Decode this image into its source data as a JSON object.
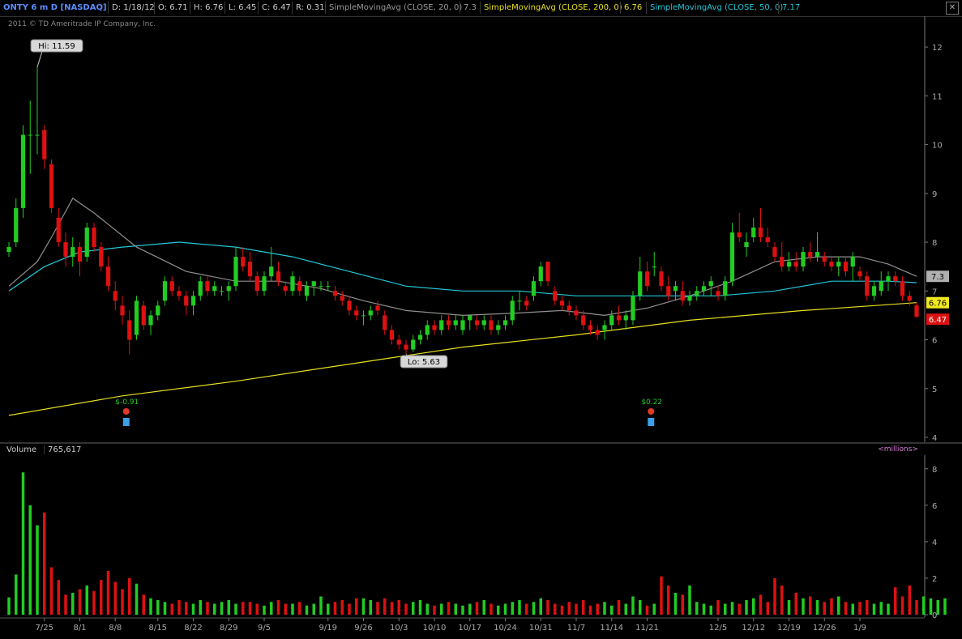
{
  "header": {
    "symbol": "ONTY 6 m D [NASDAQ]",
    "date": "D: 1/18/12",
    "open": "O: 6.71",
    "high": "H: 6.76",
    "low": "L: 6.45",
    "close": "C: 6.47",
    "range": "R: 0.31",
    "sma20_label": "SimpleMovingAvg (CLOSE, 20, 0)",
    "sma20_value": "7.3",
    "sma200_label": "SimpleMovingAvg (CLOSE, 200, 0)",
    "sma200_value": "6.76",
    "sma50_label": "SimpleMovingAvg (CLOSE, 50, 0)",
    "sma50_value": "7.17"
  },
  "copyright": "2011 © TD Ameritrade IP Company, Inc.",
  "volume_panel": {
    "label": "Volume",
    "value": "765,617",
    "unit": "<millions>"
  },
  "colors": {
    "up": "#22cc22",
    "down": "#dd1111",
    "sma20": "#909090",
    "sma50": "#22c8d8",
    "sma200": "#e8e020",
    "axis": "#777777"
  },
  "chart_data": {
    "type": "candlestick",
    "price_ylim": [
      4,
      12.3
    ],
    "price_ticks": [
      "4",
      "5",
      "6",
      "7",
      "8",
      "9",
      "10",
      "11",
      "12"
    ],
    "volume_ylim": [
      0,
      8.3
    ],
    "volume_ticks": [
      "0",
      "2",
      "4",
      "6",
      "8"
    ],
    "x_tick_labels": [
      "7/25",
      "8/1",
      "8/8",
      "8/15",
      "8/22",
      "8/29",
      "9/5",
      "9/19",
      "9/26",
      "10/3",
      "10/10",
      "10/17",
      "10/24",
      "10/31",
      "11/7",
      "11/14",
      "11/21",
      "12/5",
      "12/12",
      "12/19",
      "12/26",
      "1/9"
    ],
    "annotations": {
      "high": "Hi: 11.59",
      "low": "Lo: 5.63",
      "earnings": [
        "$-0.91",
        "$0.22"
      ]
    },
    "badges": {
      "sma20": "7.3",
      "sma200": "6.76",
      "last": "6.47"
    },
    "candles": [
      [
        7.8,
        8.0,
        7.7,
        7.9
      ],
      [
        8.0,
        8.9,
        7.9,
        8.7
      ],
      [
        8.7,
        10.4,
        8.5,
        10.2
      ],
      [
        10.2,
        10.9,
        9.4,
        10.2
      ],
      [
        10.2,
        11.59,
        9.8,
        10.2
      ],
      [
        10.3,
        10.4,
        9.5,
        9.7
      ],
      [
        9.6,
        9.7,
        8.6,
        8.7
      ],
      [
        8.5,
        8.7,
        7.9,
        8.0
      ],
      [
        8.0,
        8.2,
        7.5,
        7.7
      ],
      [
        7.7,
        8.1,
        7.5,
        7.9
      ],
      [
        7.9,
        8.0,
        7.3,
        7.6
      ],
      [
        7.7,
        8.4,
        7.6,
        8.3
      ],
      [
        8.3,
        8.4,
        7.8,
        7.9
      ],
      [
        7.9,
        8.0,
        7.4,
        7.5
      ],
      [
        7.5,
        7.7,
        7.0,
        7.1
      ],
      [
        7.0,
        7.2,
        6.6,
        6.8
      ],
      [
        6.7,
        6.9,
        6.3,
        6.5
      ],
      [
        6.4,
        6.6,
        5.7,
        6.0
      ],
      [
        6.1,
        6.9,
        6.0,
        6.8
      ],
      [
        6.7,
        6.8,
        6.2,
        6.3
      ],
      [
        6.3,
        6.6,
        6.1,
        6.5
      ],
      [
        6.5,
        6.8,
        6.4,
        6.7
      ],
      [
        6.8,
        7.3,
        6.7,
        7.2
      ],
      [
        7.2,
        7.3,
        6.9,
        7.0
      ],
      [
        7.0,
        7.1,
        6.8,
        6.9
      ],
      [
        6.9,
        7.0,
        6.5,
        6.7
      ],
      [
        6.7,
        7.0,
        6.5,
        6.9
      ],
      [
        6.9,
        7.3,
        6.8,
        7.2
      ],
      [
        7.2,
        7.3,
        6.9,
        7.0
      ],
      [
        7.0,
        7.2,
        6.9,
        7.1
      ],
      [
        7.0,
        7.1,
        6.9,
        7.0
      ],
      [
        7.0,
        7.2,
        6.8,
        7.1
      ],
      [
        7.1,
        7.9,
        7.0,
        7.7
      ],
      [
        7.7,
        7.9,
        7.4,
        7.5
      ],
      [
        7.6,
        7.8,
        7.2,
        7.3
      ],
      [
        7.3,
        7.4,
        6.9,
        7.0
      ],
      [
        7.0,
        7.4,
        6.9,
        7.3
      ],
      [
        7.3,
        7.9,
        7.2,
        7.5
      ],
      [
        7.4,
        7.6,
        7.1,
        7.2
      ],
      [
        7.1,
        7.2,
        6.9,
        7.0
      ],
      [
        7.0,
        7.4,
        6.9,
        7.3
      ],
      [
        7.2,
        7.3,
        6.9,
        7.0
      ],
      [
        6.9,
        7.2,
        6.8,
        7.1
      ],
      [
        7.1,
        7.2,
        6.9,
        7.2
      ],
      [
        7.1,
        7.2,
        7.0,
        7.1
      ],
      [
        7.1,
        7.2,
        7.0,
        7.1
      ],
      [
        7.0,
        7.1,
        6.8,
        6.9
      ],
      [
        6.9,
        7.0,
        6.7,
        6.8
      ],
      [
        6.8,
        6.9,
        6.5,
        6.6
      ],
      [
        6.6,
        6.7,
        6.4,
        6.5
      ],
      [
        6.5,
        6.6,
        6.3,
        6.5
      ],
      [
        6.5,
        6.7,
        6.4,
        6.6
      ],
      [
        6.7,
        6.8,
        6.5,
        6.6
      ],
      [
        6.5,
        6.6,
        6.1,
        6.2
      ],
      [
        6.2,
        6.3,
        5.9,
        6.0
      ],
      [
        6.0,
        6.1,
        5.8,
        5.9
      ],
      [
        5.9,
        6.0,
        5.7,
        5.8
      ],
      [
        5.8,
        6.1,
        5.75,
        6.0
      ],
      [
        6.0,
        6.2,
        5.9,
        6.1
      ],
      [
        6.1,
        6.4,
        6.0,
        6.3
      ],
      [
        6.3,
        6.4,
        6.1,
        6.2
      ],
      [
        6.2,
        6.5,
        6.1,
        6.4
      ],
      [
        6.4,
        6.5,
        6.2,
        6.3
      ],
      [
        6.3,
        6.5,
        6.2,
        6.4
      ],
      [
        6.2,
        6.5,
        6.1,
        6.4
      ],
      [
        6.4,
        6.5,
        6.2,
        6.5
      ],
      [
        6.4,
        6.5,
        6.2,
        6.3
      ],
      [
        6.3,
        6.5,
        6.2,
        6.4
      ],
      [
        6.4,
        6.5,
        6.1,
        6.2
      ],
      [
        6.2,
        6.4,
        6.1,
        6.3
      ],
      [
        6.3,
        6.5,
        6.2,
        6.4
      ],
      [
        6.4,
        6.9,
        6.3,
        6.8
      ],
      [
        6.8,
        7.0,
        6.6,
        6.8
      ],
      [
        6.8,
        6.9,
        6.6,
        6.7
      ],
      [
        6.9,
        7.3,
        6.8,
        7.2
      ],
      [
        7.2,
        7.6,
        7.1,
        7.5
      ],
      [
        7.6,
        7.6,
        7.1,
        7.2
      ],
      [
        7.0,
        7.1,
        6.7,
        6.8
      ],
      [
        6.8,
        6.9,
        6.6,
        6.7
      ],
      [
        6.7,
        6.8,
        6.5,
        6.6
      ],
      [
        6.6,
        6.7,
        6.4,
        6.5
      ],
      [
        6.5,
        6.6,
        6.2,
        6.3
      ],
      [
        6.3,
        6.4,
        6.1,
        6.2
      ],
      [
        6.2,
        6.3,
        6.0,
        6.1
      ],
      [
        6.2,
        6.4,
        6.0,
        6.3
      ],
      [
        6.3,
        6.6,
        6.2,
        6.5
      ],
      [
        6.5,
        6.7,
        6.3,
        6.4
      ],
      [
        6.4,
        6.6,
        6.2,
        6.5
      ],
      [
        6.4,
        7.0,
        6.3,
        6.9
      ],
      [
        6.9,
        7.7,
        6.8,
        7.4
      ],
      [
        7.4,
        7.6,
        7.0,
        7.1
      ],
      [
        7.5,
        7.8,
        7.3,
        7.5
      ],
      [
        7.4,
        7.5,
        7.0,
        7.1
      ],
      [
        7.1,
        7.3,
        6.8,
        6.9
      ],
      [
        7.0,
        7.2,
        6.8,
        7.1
      ],
      [
        7.0,
        7.2,
        6.7,
        6.8
      ],
      [
        6.8,
        7.0,
        6.7,
        6.9
      ],
      [
        6.9,
        7.1,
        6.8,
        7.0
      ],
      [
        7.0,
        7.2,
        6.9,
        7.1
      ],
      [
        7.1,
        7.3,
        6.9,
        7.2
      ],
      [
        7.0,
        7.1,
        6.8,
        6.9
      ],
      [
        6.9,
        7.3,
        6.8,
        7.2
      ],
      [
        7.2,
        8.4,
        7.1,
        8.2
      ],
      [
        8.2,
        8.6,
        8.0,
        8.1
      ],
      [
        7.9,
        8.2,
        7.7,
        8.0
      ],
      [
        8.1,
        8.5,
        8.0,
        8.3
      ],
      [
        8.3,
        8.7,
        8.0,
        8.1
      ],
      [
        8.1,
        8.3,
        7.9,
        8.0
      ],
      [
        7.9,
        8.0,
        7.6,
        7.7
      ],
      [
        7.7,
        8.0,
        7.4,
        7.5
      ],
      [
        7.5,
        7.8,
        7.4,
        7.6
      ],
      [
        7.6,
        7.8,
        7.4,
        7.5
      ],
      [
        7.5,
        7.9,
        7.4,
        7.8
      ],
      [
        7.8,
        8.0,
        7.6,
        7.7
      ],
      [
        7.7,
        8.2,
        7.6,
        7.8
      ],
      [
        7.7,
        7.8,
        7.5,
        7.6
      ],
      [
        7.6,
        7.7,
        7.4,
        7.5
      ],
      [
        7.5,
        7.7,
        7.3,
        7.6
      ],
      [
        7.6,
        7.7,
        7.3,
        7.4
      ],
      [
        7.5,
        7.8,
        7.2,
        7.7
      ],
      [
        7.4,
        7.5,
        7.2,
        7.3
      ],
      [
        7.3,
        7.4,
        6.8,
        6.9
      ],
      [
        6.9,
        7.2,
        6.8,
        7.1
      ],
      [
        7.0,
        7.4,
        6.9,
        7.2
      ],
      [
        7.2,
        7.4,
        7.0,
        7.3
      ],
      [
        7.3,
        7.4,
        7.1,
        7.2
      ],
      [
        7.2,
        7.3,
        6.8,
        6.9
      ],
      [
        6.9,
        7.0,
        6.7,
        6.8
      ],
      [
        6.71,
        6.76,
        6.45,
        6.47
      ]
    ],
    "sma20": [
      [
        0,
        7.1
      ],
      [
        4,
        7.6
      ],
      [
        6,
        8.1
      ],
      [
        9,
        8.9
      ],
      [
        12,
        8.6
      ],
      [
        18,
        7.9
      ],
      [
        25,
        7.4
      ],
      [
        32,
        7.2
      ],
      [
        38,
        7.2
      ],
      [
        44,
        7.05
      ],
      [
        50,
        6.8
      ],
      [
        56,
        6.6
      ],
      [
        64,
        6.5
      ],
      [
        72,
        6.55
      ],
      [
        78,
        6.6
      ],
      [
        84,
        6.5
      ],
      [
        90,
        6.65
      ],
      [
        96,
        6.9
      ],
      [
        102,
        7.2
      ],
      [
        108,
        7.6
      ],
      [
        114,
        7.7
      ],
      [
        120,
        7.7
      ],
      [
        124,
        7.55
      ],
      [
        128,
        7.3
      ]
    ],
    "sma50": [
      [
        0,
        7.0
      ],
      [
        5,
        7.5
      ],
      [
        10,
        7.8
      ],
      [
        16,
        7.9
      ],
      [
        24,
        8.0
      ],
      [
        32,
        7.9
      ],
      [
        40,
        7.7
      ],
      [
        48,
        7.4
      ],
      [
        56,
        7.1
      ],
      [
        64,
        7.0
      ],
      [
        72,
        7.0
      ],
      [
        80,
        6.9
      ],
      [
        90,
        6.9
      ],
      [
        100,
        6.9
      ],
      [
        108,
        7.0
      ],
      [
        116,
        7.2
      ],
      [
        124,
        7.2
      ],
      [
        128,
        7.17
      ]
    ],
    "sma200": [
      [
        0,
        4.45
      ],
      [
        16,
        4.85
      ],
      [
        32,
        5.15
      ],
      [
        48,
        5.5
      ],
      [
        64,
        5.85
      ],
      [
        80,
        6.1
      ],
      [
        96,
        6.4
      ],
      [
        112,
        6.6
      ],
      [
        128,
        6.76
      ]
    ],
    "volume": [
      0.95,
      2.2,
      7.8,
      6.0,
      4.9,
      5.6,
      2.6,
      1.9,
      1.1,
      1.2,
      1.4,
      1.6,
      1.3,
      1.9,
      2.4,
      1.8,
      1.4,
      2.0,
      1.7,
      1.1,
      0.9,
      0.8,
      0.7,
      0.6,
      0.8,
      0.7,
      0.6,
      0.8,
      0.7,
      0.6,
      0.7,
      0.8,
      0.6,
      0.7,
      0.7,
      0.6,
      0.5,
      0.7,
      0.8,
      0.6,
      0.6,
      0.7,
      0.5,
      0.6,
      1.0,
      0.6,
      0.7,
      0.8,
      0.6,
      0.9,
      0.9,
      0.8,
      0.7,
      0.9,
      0.7,
      0.8,
      0.6,
      0.7,
      0.8,
      0.6,
      0.5,
      0.6,
      0.7,
      0.6,
      0.5,
      0.6,
      0.7,
      0.8,
      0.6,
      0.5,
      0.6,
      0.7,
      0.8,
      0.6,
      0.7,
      0.9,
      0.8,
      0.6,
      0.5,
      0.7,
      0.6,
      0.8,
      0.5,
      0.6,
      0.7,
      0.5,
      0.8,
      0.6,
      1.0,
      0.8,
      0.5,
      0.6,
      2.1,
      1.6,
      1.2,
      1.1,
      1.6,
      0.7,
      0.6,
      0.5,
      0.8,
      0.6,
      0.7,
      0.6,
      0.8,
      0.9,
      1.1,
      0.7,
      2.0,
      1.6,
      0.8,
      1.2,
      0.9,
      1.0,
      0.8,
      0.7,
      0.9,
      1.0,
      0.7,
      0.6,
      0.7,
      0.8,
      0.6,
      0.7,
      0.6,
      1.5,
      1.0,
      1.6,
      0.8,
      1.0,
      0.9,
      0.8,
      0.9
    ]
  }
}
